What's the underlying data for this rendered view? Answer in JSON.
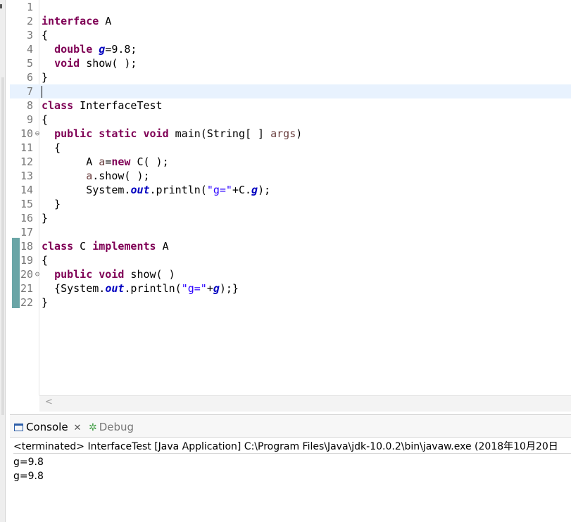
{
  "editor": {
    "lines": [
      {
        "n": "1"
      },
      {
        "n": "2",
        "t": [
          [
            "kw",
            "interface"
          ],
          [
            "",
            " A"
          ]
        ]
      },
      {
        "n": "3",
        "t": [
          [
            "",
            "{"
          ]
        ]
      },
      {
        "n": "4",
        "t": [
          [
            "",
            "  "
          ],
          [
            "kw",
            "double"
          ],
          [
            "",
            " "
          ],
          [
            "fld",
            "g"
          ],
          [
            "",
            "=9.8;"
          ]
        ]
      },
      {
        "n": "5",
        "t": [
          [
            "",
            "  "
          ],
          [
            "kw",
            "void"
          ],
          [
            "",
            " show( );"
          ]
        ]
      },
      {
        "n": "6",
        "t": [
          [
            "",
            "}"
          ]
        ]
      },
      {
        "n": "7",
        "current": true,
        "caret": true
      },
      {
        "n": "8",
        "t": [
          [
            "kw",
            "class"
          ],
          [
            "",
            " InterfaceTest"
          ]
        ]
      },
      {
        "n": "9",
        "t": [
          [
            "",
            "{"
          ]
        ]
      },
      {
        "n": "10",
        "fold": "⊖",
        "t": [
          [
            "",
            "  "
          ],
          [
            "kw",
            "public"
          ],
          [
            "",
            " "
          ],
          [
            "kw",
            "static"
          ],
          [
            "",
            " "
          ],
          [
            "kw",
            "void"
          ],
          [
            "",
            " main(String[ ] "
          ],
          [
            "loc",
            "args"
          ],
          [
            "",
            ")"
          ]
        ]
      },
      {
        "n": "11",
        "t": [
          [
            "",
            "  {"
          ]
        ]
      },
      {
        "n": "12",
        "t": [
          [
            "",
            "       A "
          ],
          [
            "loc",
            "a"
          ],
          [
            "",
            "="
          ],
          [
            "kw",
            "new"
          ],
          [
            "",
            " C( );"
          ]
        ]
      },
      {
        "n": "13",
        "t": [
          [
            "",
            "       "
          ],
          [
            "loc",
            "a"
          ],
          [
            "",
            ".show( );"
          ]
        ]
      },
      {
        "n": "14",
        "t": [
          [
            "",
            "       System."
          ],
          [
            "fld",
            "out"
          ],
          [
            "",
            ".println("
          ],
          [
            "str",
            "\"g=\""
          ],
          [
            "",
            "+C."
          ],
          [
            "fld",
            "g"
          ],
          [
            "",
            ");"
          ]
        ]
      },
      {
        "n": "15",
        "t": [
          [
            "",
            "  }"
          ]
        ]
      },
      {
        "n": "16",
        "t": [
          [
            "",
            "}"
          ]
        ]
      },
      {
        "n": "17"
      },
      {
        "n": "18",
        "t": [
          [
            "kw",
            "class"
          ],
          [
            "",
            " C "
          ],
          [
            "kw",
            "implements"
          ],
          [
            "",
            " A"
          ]
        ]
      },
      {
        "n": "19",
        "t": [
          [
            "",
            "{"
          ]
        ]
      },
      {
        "n": "20",
        "fold": "⊖",
        "t": [
          [
            "",
            "  "
          ],
          [
            "kw",
            "public"
          ],
          [
            "",
            " "
          ],
          [
            "kw",
            "void"
          ],
          [
            "",
            " show( )"
          ]
        ]
      },
      {
        "n": "21",
        "t": [
          [
            "",
            "  {System."
          ],
          [
            "fld",
            "out"
          ],
          [
            "",
            ".println("
          ],
          [
            "str",
            "\"g=\""
          ],
          [
            "",
            "+"
          ],
          [
            "fld",
            "g"
          ],
          [
            "",
            ");}"
          ]
        ]
      },
      {
        "n": "22",
        "t": [
          [
            "",
            "}"
          ]
        ]
      }
    ],
    "hscroll_arrow": "<"
  },
  "console": {
    "tab_console": "Console",
    "tab_console_close": "✕",
    "tab_debug": "Debug",
    "terminated": "<terminated> InterfaceTest [Java Application] C:\\Program Files\\Java\\jdk-10.0.2\\bin\\javaw.exe (2018年10月20日",
    "output": [
      "g=9.8",
      "g=9.8"
    ]
  },
  "colors": {
    "keyword": "#7f0055",
    "field": "#0000c0",
    "string": "#2a00ff",
    "local": "#6a3e3e",
    "line_number": "#787878",
    "current_line": "#e8f2fe",
    "diff_bar": "#6aa5a6"
  },
  "icons": [
    "console-icon",
    "close-icon",
    "debug-bug-icon",
    "fold-collapse-icon",
    "scroll-left-icon"
  ]
}
